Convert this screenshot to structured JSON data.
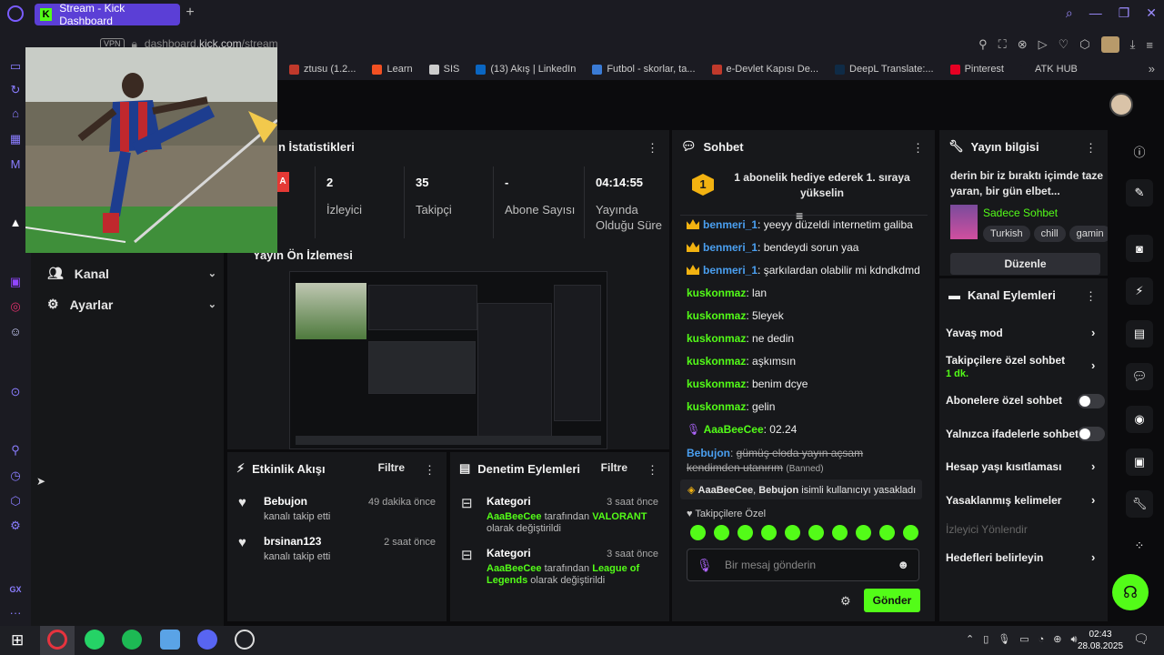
{
  "browser": {
    "tab_title": "Stream - Kick Dashboard",
    "favicon_letter": "K",
    "url_vpn": "VPN",
    "url_prefix": "dashboard.",
    "url_host": "kick.com",
    "url_path": "/stream",
    "bookmarks": [
      {
        "label": "ztusu (1.2...",
        "color": "#c0392b"
      },
      {
        "label": "Learn",
        "color": "#f25022"
      },
      {
        "label": "SIS",
        "color": "#cccccc"
      },
      {
        "label": "(13) Akış | LinkedIn",
        "color": "#0a66c2"
      },
      {
        "label": "Futbol - skorlar, ta...",
        "color": "#3a7bd5"
      },
      {
        "label": "e-Devlet Kapısı De...",
        "color": "#c0392b"
      },
      {
        "label": "DeepL Translate:...",
        "color": "#0f2b46"
      },
      {
        "label": "Pinterest",
        "color": "#e60023"
      },
      {
        "label": "ATK HUB",
        "color": "#1b1b22"
      }
    ]
  },
  "left_menu": {
    "items": [
      {
        "label": "Kanal",
        "icon": "users-icon"
      },
      {
        "label": "Ayarlar",
        "icon": "gear-icon"
      }
    ]
  },
  "stats": {
    "title": "n İstatistikleri",
    "first_badge": "A",
    "cards": [
      {
        "value": "2",
        "label": "İzleyici"
      },
      {
        "value": "35",
        "label": "Takipçi"
      },
      {
        "value": "-",
        "label": "Abone Sayısı"
      },
      {
        "value": "04:14:55",
        "label": "Yayında Olduğu Süre"
      }
    ]
  },
  "preview": {
    "title": "Yayın Ön İzlemesi"
  },
  "activity": {
    "title": "Etkinlik Akışı",
    "filter": "Filtre",
    "events": [
      {
        "name": "Bebujon",
        "sub": "kanalı takip etti",
        "time": "49 dakika önce"
      },
      {
        "name": "brsinan123",
        "sub": "kanalı takip etti",
        "time": "2 saat önce"
      }
    ]
  },
  "moderation": {
    "title": "Denetim Eylemleri",
    "filter": "Filtre",
    "events": [
      {
        "name": "Kategori",
        "time": "3 saat önce",
        "user": "AaaBeeCee",
        "mid": "tarafından",
        "value": "VALORANT",
        "tail": "olarak değiştirildi"
      },
      {
        "name": "Kategori",
        "time": "3 saat önce",
        "user": "AaaBeeCee",
        "mid": "tarafından",
        "value": "League of Legends",
        "tail": "olarak değiştirildi"
      }
    ]
  },
  "chat": {
    "title": "Sohbet",
    "gift_rank": "1",
    "gift_text": "1 abonelik hediye ederek 1. sıraya yükselin",
    "messages": [
      {
        "user": "benmeri_1",
        "text": "yeeyy düzeldi internetim galiba",
        "style": "blue",
        "crown": true
      },
      {
        "user": "benmeri_1",
        "text": "bendeydi sorun yaa",
        "style": "blue",
        "crown": true
      },
      {
        "user": "benmeri_1",
        "text": "şarkılardan olabilir mi kdndkdmd",
        "style": "blue",
        "crown": true
      },
      {
        "user": "kuskonmaz",
        "text": "lan",
        "style": "green"
      },
      {
        "user": "kuskonmaz",
        "text": "5leyek",
        "style": "green"
      },
      {
        "user": "kuskonmaz",
        "text": "ne dedin",
        "style": "green"
      },
      {
        "user": "kuskonmaz",
        "text": "aşkımsın",
        "style": "green"
      },
      {
        "user": "kuskonmaz",
        "text": "benim dcye",
        "style": "green"
      },
      {
        "user": "kuskonmaz",
        "text": "gelin",
        "style": "green"
      },
      {
        "user": "AaaBeeCee",
        "text": "02.24",
        "style": "green"
      }
    ],
    "banned_user": "Bebujon",
    "banned_text": "gümüş eloda yayın açsam kendimden utanırım",
    "banned_tag": "(Banned)",
    "mod_notice": "isimli kullanıcıyı yasakladı",
    "mod_notice_actor": "AaaBeeCee",
    "mod_notice_target": "Bebujon",
    "emote_section": "Takipçilere Özel",
    "input_placeholder": "Bir mesaj gönderin",
    "send_label": "Gönder"
  },
  "stream_info": {
    "title": "Yayın bilgisi",
    "stream_title": "derin bir iz bıraktı içimde taze yaran, bir gün elbet...",
    "category": "Sadece Sohbet",
    "tags": [
      "Turkish",
      "chill",
      "gamin"
    ],
    "edit_label": "Düzenle"
  },
  "channel_actions": {
    "title": "Kanal Eylemleri",
    "slow_mode": "Yavaş mod",
    "followers_only": "Takipçilere özel sohbet",
    "followers_only_value": "1 dk.",
    "subs_only": "Abonelere özel sohbet",
    "emotes_only": "Yalnızca ifadelerle sohbet",
    "account_age": "Hesap yaşı kısıtlaması",
    "banned_words": "Yasaklanmış kelimeler",
    "redirect": "İzleyici Yönlendir",
    "goals": "Hedefleri belirleyin"
  },
  "taskbar": {
    "time": "02:43",
    "date": "28.08.2025"
  }
}
